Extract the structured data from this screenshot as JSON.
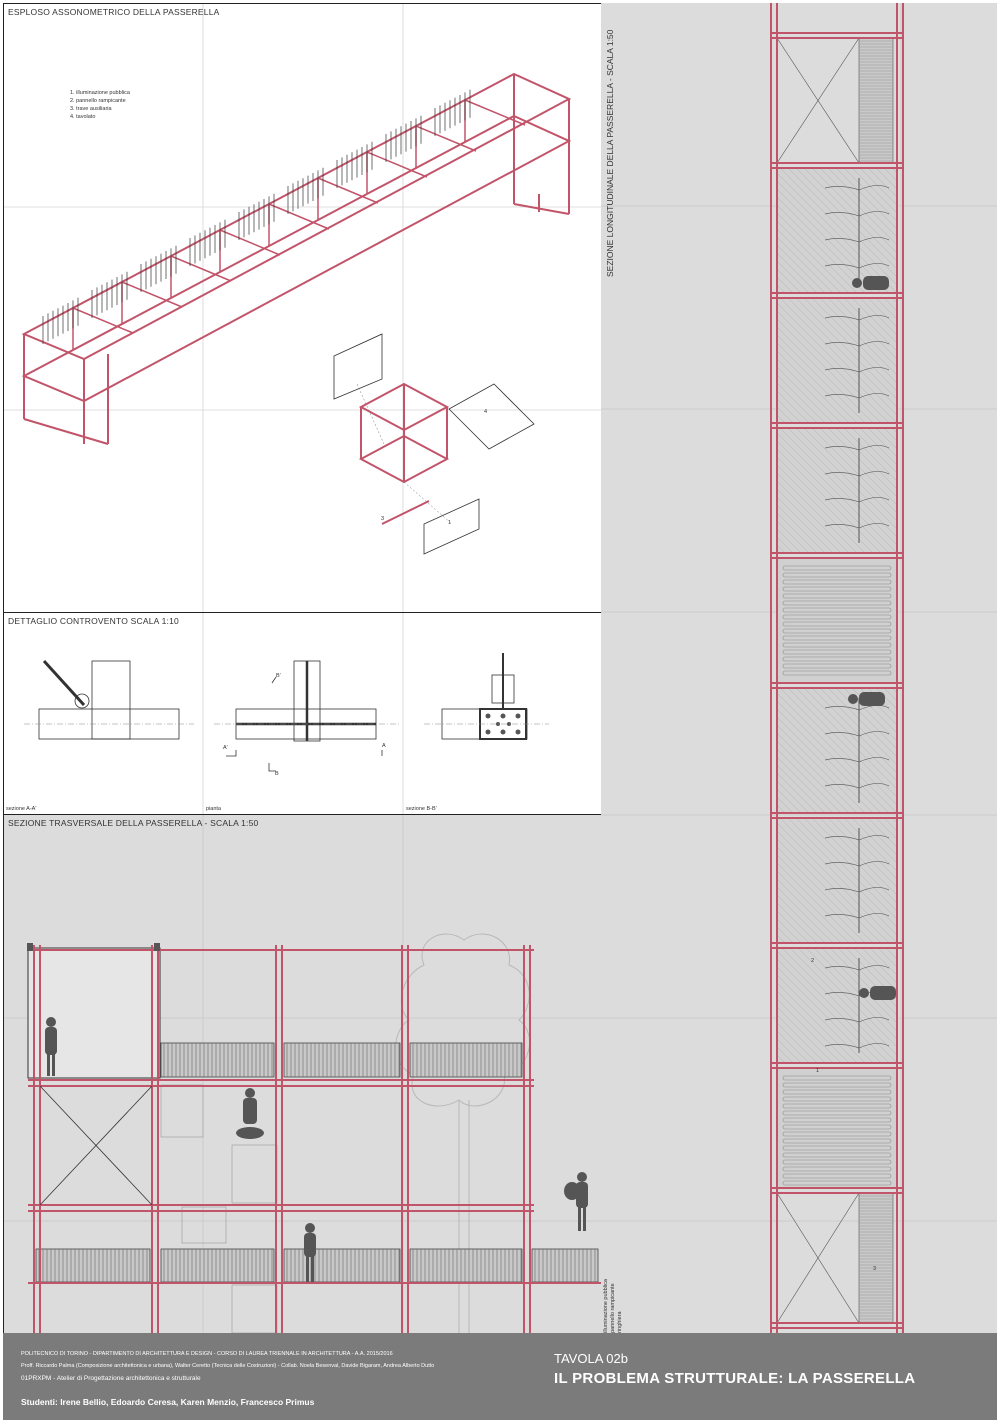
{
  "panels": {
    "exploded": {
      "title": "ESPLOSO ASSONOMETRICO DELLA PASSERELLA",
      "legend": [
        "1. illuminazione pubblica",
        "2. pannello rampicante",
        "3. trave ausiliaria",
        "4. tavolato"
      ],
      "callouts": [
        "1",
        "3",
        "4"
      ]
    },
    "detail": {
      "title": "DETTAGLIO CONTROVENTO SCALA 1:10",
      "subviews": [
        "sezione A-A'",
        "pianta",
        "sezione B-B'"
      ],
      "section_marks": [
        "A'",
        "A",
        "B",
        "B'"
      ]
    },
    "transversal": {
      "title": "SEZIONE TRASVERSALE DELLA PASSERELLA - SCALA 1:50"
    },
    "longitudinal": {
      "title": "SEZIONE LONGITUDINALE DELLA PASSERELLA - SCALA 1:50",
      "legend": [
        "1. illuminazione pubblica",
        "2. pannello rampicante",
        "3. ringhiera"
      ],
      "callouts": [
        "1",
        "2",
        "3"
      ]
    }
  },
  "footer": {
    "institution": "POLITECNICO DI TORINO - DIPARTIMENTO DI ARCHITETTURA E DESIGN - CORSO DI LAUREA TRIENNALE IN ARCHITETTURA - A.A. 2015/2016",
    "professors": "Proff. Riccardo Palma (Composizione architettonica e urbana), Walter Ceretto (Tecnica delle Costruzioni) - Collab. Noela Besenval, Davide Bigaram, Andrea Alberto Dutto",
    "course": "01PRXPM - Atelier di Progettazione architettonica e strutturale",
    "students": "Studenti: Irene Bellio, Edoardo Ceresa, Karen Menzio, Francesco Primus",
    "board_number": "TAVOLA 02b",
    "board_title": "IL PROBLEMA STRUTTURALE: LA PASSERELLA"
  },
  "colors": {
    "structure": "#c2546a",
    "drawing_bg": "#dcdcdc",
    "footer_bg": "#7b7b7b",
    "silhouette": "#555555"
  }
}
